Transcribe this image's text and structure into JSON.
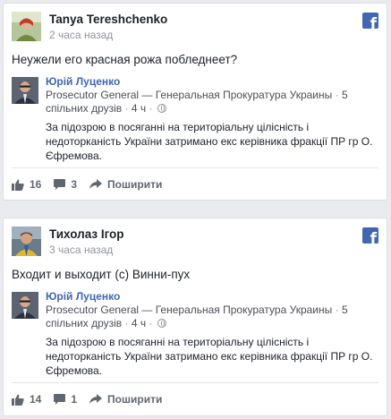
{
  "posts": [
    {
      "author": "Tanya Tereshchenko",
      "timestamp": "2 часа назад",
      "text": "Неужели его красная рожа побледнеет?",
      "shared": {
        "name": "Юрій Луценко",
        "meta_title": "Prosecutor General — Генеральная Прокуратура Украины",
        "meta_friends": "5 спільних друзів",
        "meta_time": "4 ч",
        "text": "За підозрою в посяганні на територіальну цілісність і недоторканість України затримано екс керівника фракції ПР гр О. Єфремова."
      },
      "likes": "16",
      "comments": "3",
      "share_label": "Поширити"
    },
    {
      "author": "Тихолаз Ігор",
      "timestamp": "3 часа назад",
      "text": "Входит и выходит (с) Винни-пух",
      "shared": {
        "name": "Юрій Луценко",
        "meta_title": "Prosecutor General — Генеральная Прокуратура Украины",
        "meta_friends": "5 спільних друзів",
        "meta_time": "4 ч",
        "text": "За підозрою в посяганні на територіальну цілісність і недоторканість України затримано екс керівника фракції ПР гр О. Єфремова."
      },
      "likes": "14",
      "comments": "1",
      "share_label": "Поширити"
    }
  ],
  "icons": {
    "facebook": "facebook-logo-icon",
    "like": "thumbs-up-icon",
    "comment": "comment-bubble-icon",
    "share": "share-arrow-icon",
    "privacy": "globe-icon"
  },
  "colors": {
    "facebook_blue": "#4267b2",
    "meta_gray": "#90949c",
    "action_gray": "#616770"
  }
}
